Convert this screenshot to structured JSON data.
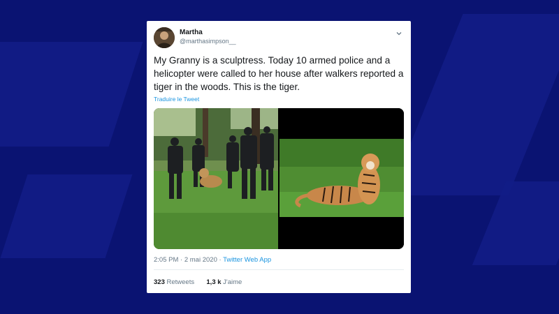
{
  "tweet": {
    "author_name": "Martha",
    "author_handle": "@marthasimpson__",
    "text": "My Granny is a sculptress. Today 10 armed police and a helicopter were called to her house after walkers reported a tiger in the woods. This is the tiger.",
    "translate_label": "Traduire le Tweet",
    "time": "2:05 PM",
    "date": "2 mai 2020",
    "source": "Twitter Web App",
    "retweets_count": "323",
    "retweets_label": "Retweets",
    "likes_count": "1,3 k",
    "likes_label": "J'aime"
  },
  "icons": {
    "menu": "chevron-down-icon"
  },
  "colors": {
    "background": "#0a1372",
    "link": "#1b95e0",
    "secondary_text": "#657786"
  }
}
